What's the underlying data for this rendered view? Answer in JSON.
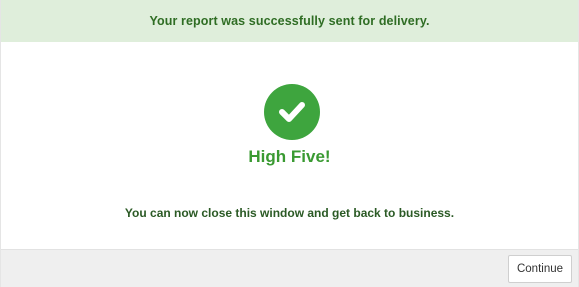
{
  "banner": {
    "message": "Your report was successfully sent for delivery."
  },
  "success": {
    "icon": "checkmark-icon",
    "headline": "High Five!",
    "message": "You can now close this window and get back to business."
  },
  "footer": {
    "continue_label": "Continue"
  },
  "colors": {
    "banner_bg": "#dfeedb",
    "accent_green": "#3ea53e",
    "footer_bg": "#efefef"
  }
}
